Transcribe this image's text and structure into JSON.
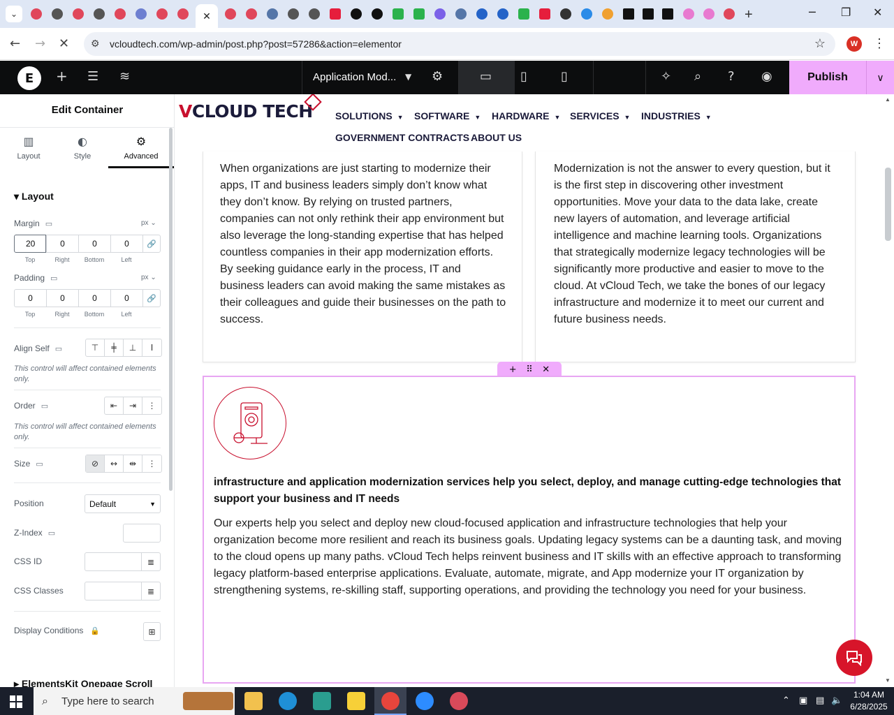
{
  "browser": {
    "url": "vcloudtech.com/wp-admin/post.php?post=57286&action=elementor",
    "profile_initial": "W",
    "new_tab": "+",
    "tab_close": "✕"
  },
  "editor": {
    "document_title": "Application Mod...",
    "publish_label": "Publish"
  },
  "panel": {
    "title": "Edit Container",
    "tabs": [
      {
        "label": "Layout",
        "icon": "layout-icon"
      },
      {
        "label": "Style",
        "icon": "style-icon"
      },
      {
        "label": "Advanced",
        "icon": "gear-icon"
      }
    ],
    "section": "Layout",
    "margin": {
      "label": "Margin",
      "unit": "px",
      "top": "20",
      "right": "0",
      "bottom": "0",
      "left": "0"
    },
    "padding": {
      "label": "Padding",
      "unit": "px",
      "top": "0",
      "right": "0",
      "bottom": "0",
      "left": "0"
    },
    "dim_labels": {
      "top": "Top",
      "right": "Right",
      "bottom": "Bottom",
      "left": "Left"
    },
    "align_self": {
      "label": "Align Self",
      "note": "This control will affect contained elements only."
    },
    "order": {
      "label": "Order",
      "note": "This control will affect contained elements only."
    },
    "size": {
      "label": "Size"
    },
    "position": {
      "label": "Position",
      "value": "Default"
    },
    "zindex": {
      "label": "Z-Index"
    },
    "css_id": {
      "label": "CSS ID"
    },
    "css_classes": {
      "label": "CSS Classes"
    },
    "display_conditions": {
      "label": "Display Conditions"
    },
    "footer_section": "ElementsKit Onepage Scroll"
  },
  "site": {
    "logo_v": "V",
    "logo_rest": "CLOUD TECH",
    "menu": [
      {
        "label": "SOLUTIONS",
        "has_dropdown": true
      },
      {
        "label": "SOFTWARE",
        "has_dropdown": true
      },
      {
        "label": "HARDWARE",
        "has_dropdown": true
      },
      {
        "label": "SERVICES",
        "has_dropdown": true
      },
      {
        "label": "INDUSTRIES",
        "has_dropdown": true
      },
      {
        "label": "GOVERNMENT CONTRACTS",
        "has_dropdown": false
      },
      {
        "label": "ABOUT US",
        "has_dropdown": false
      }
    ],
    "card_left": "When organizations are just starting to modernize their apps, IT and business leaders simply don’t know what they don’t know. By relying on trusted partners, companies can not only rethink their app environment but also leverage the long-standing expertise that has helped countless companies in their app modernization efforts. By seeking guidance early in the process, IT and business leaders can avoid making the same mistakes as their colleagues and guide their businesses on the path to success.",
    "card_right": "Modernization is not the answer to every question, but it is the first step in discovering other investment opportunities. Move your data to the data lake, create new layers of automation, and leverage artificial intelligence and machine learning tools. Organizations that strategically modernize legacy technologies will be significantly more productive and easier to move to the cloud. At vCloud Tech, we take the bones of our legacy infrastructure and modernize it to meet our current and future business needs.",
    "heading": "infrastructure and application modernization services help you select, deploy, and manage cutting-edge technologies that support your business and IT needs",
    "body": "Our experts help you select and deploy new cloud-focused application and infrastructure technologies that help your organization become more resilient and reach its business goals. Updating legacy systems can be a daunting task, and moving to the cloud opens up many paths. vCloud Tech helps reinvent business and IT skills with an effective approach to transforming legacy platform-based enterprise applications. Evaluate, automate, migrate, and App modernize your IT organization by strengthening systems, re-skilling staff, supporting operations, and providing the technology you need for your business."
  },
  "taskbar": {
    "search_placeholder": "Type here to search",
    "time": "1:04 AM",
    "date": "6/28/2025"
  },
  "colors": {
    "accent_pink": "#f0abfc",
    "brand_red": "#c8102e",
    "editor_bar": "#0c0d0e"
  }
}
